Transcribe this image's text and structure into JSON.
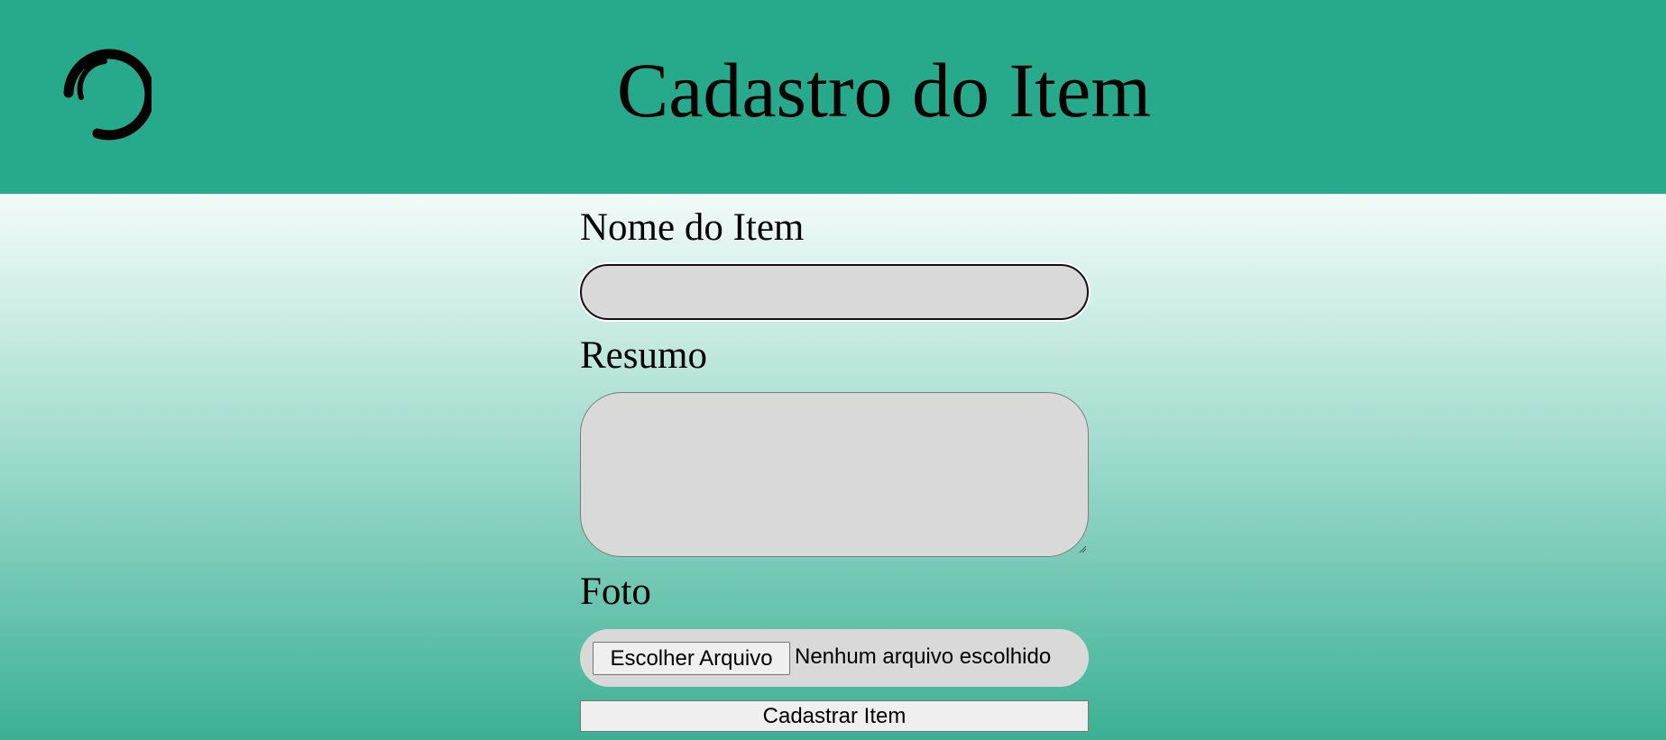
{
  "header": {
    "title": "Cadastro do Item",
    "background_color": "#27a98c",
    "logo_icon": "loading-arc-icon"
  },
  "form": {
    "name_label": "Nome do Item",
    "name_value": "",
    "summary_label": "Resumo",
    "summary_value": "",
    "photo_label": "Foto",
    "file_button_label": "Escolher Arquivo",
    "file_status": "Nenhum arquivo escolhido",
    "submit_label": "Cadastrar Item",
    "field_color": "#d9d9d9"
  },
  "page": {
    "gradient_top_color": "#f3fbf9",
    "gradient_bottom_color": "#3bb094"
  }
}
